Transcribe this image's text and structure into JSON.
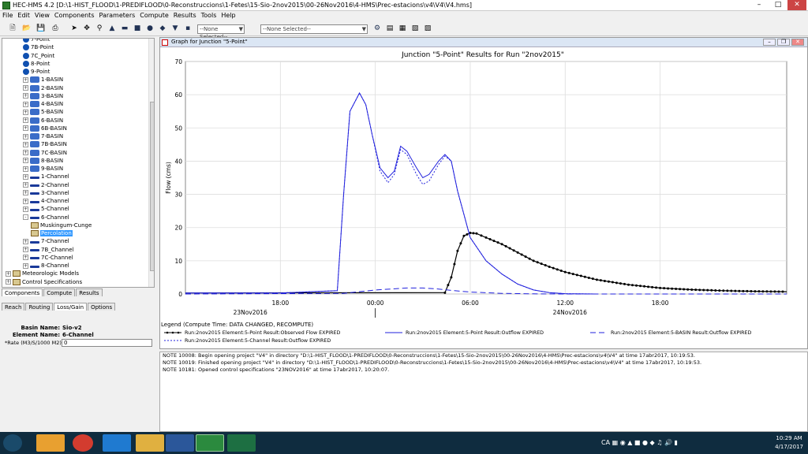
{
  "window": {
    "title": "HEC-HMS 4.2 [D:\\1-HIST_FLOOD\\1-PREDIFLOOD\\0-Reconstruccions\\1-Fetes\\15-Sio-2nov2015\\00-26Nov2016\\4-HMS\\Prec-estacions\\v4\\V4\\V4.hms]"
  },
  "menu": [
    "File",
    "Edit",
    "View",
    "Components",
    "Parameters",
    "Compute",
    "Results",
    "Tools",
    "Help"
  ],
  "toolbar": {
    "combo1": "--None Selected--",
    "combo2": "--None Selected--"
  },
  "tree": [
    {
      "label": "7-Point",
      "icon": "point-icon",
      "expand": ""
    },
    {
      "label": "7B-Point",
      "icon": "point-icon",
      "expand": ""
    },
    {
      "label": "7C_Point",
      "icon": "point-icon",
      "expand": ""
    },
    {
      "label": "8-Point",
      "icon": "point-icon",
      "expand": ""
    },
    {
      "label": "9-Point",
      "icon": "point-icon",
      "expand": ""
    },
    {
      "label": "1-BASIN",
      "icon": "basin-icon",
      "expand": "+"
    },
    {
      "label": "2-BASIN",
      "icon": "basin-icon",
      "expand": "+"
    },
    {
      "label": "3-BASIN",
      "icon": "basin-icon",
      "expand": "+"
    },
    {
      "label": "4-BASIN",
      "icon": "basin-icon",
      "expand": "+"
    },
    {
      "label": "5-BASIN",
      "icon": "basin-icon",
      "expand": "+"
    },
    {
      "label": "6-BASIN",
      "icon": "basin-icon",
      "expand": "+"
    },
    {
      "label": "6B-BASIN",
      "icon": "basin-icon",
      "expand": "+"
    },
    {
      "label": "7-BASIN",
      "icon": "basin-icon",
      "expand": "+"
    },
    {
      "label": "7B-BASIN",
      "icon": "basin-icon",
      "expand": "+"
    },
    {
      "label": "7C-BASIN",
      "icon": "basin-icon",
      "expand": "+"
    },
    {
      "label": "8-BASIN",
      "icon": "basin-icon",
      "expand": "+"
    },
    {
      "label": "9-BASIN",
      "icon": "basin-icon",
      "expand": "+"
    },
    {
      "label": "1-Channel",
      "icon": "channel-icon",
      "expand": "+"
    },
    {
      "label": "2-Channel",
      "icon": "channel-icon",
      "expand": "+"
    },
    {
      "label": "3-Channel",
      "icon": "channel-icon",
      "expand": "+"
    },
    {
      "label": "4-Channel",
      "icon": "channel-icon",
      "expand": "+"
    },
    {
      "label": "5-Channel",
      "icon": "channel-icon",
      "expand": "+"
    },
    {
      "label": "6-Channel",
      "icon": "channel-icon",
      "expand": "-"
    },
    {
      "label": "Muskingum-Cunge",
      "icon": "method-icon",
      "expand": "",
      "indent": 1
    },
    {
      "label": "Percolation",
      "icon": "method-icon",
      "expand": "",
      "indent": 1,
      "selected": true
    },
    {
      "label": "7-Channel",
      "icon": "channel-icon",
      "expand": "+"
    },
    {
      "label": "7B_Channel",
      "icon": "channel-icon",
      "expand": "+"
    },
    {
      "label": "7C-Channel",
      "icon": "channel-icon",
      "expand": "+"
    },
    {
      "label": "8-Channel",
      "icon": "channel-icon",
      "expand": "+"
    },
    {
      "label": "Meteorologic Models",
      "icon": "folder-icon",
      "expand": "+",
      "indent": -1
    },
    {
      "label": "Control Specifications",
      "icon": "folder-icon",
      "expand": "+",
      "indent": -1
    }
  ],
  "left_tabs": [
    "Components",
    "Compute",
    "Results"
  ],
  "prop_tabs": [
    "Reach",
    "Routing",
    "Loss/Gain",
    "Options"
  ],
  "props": {
    "basin_label": "Basin Name:",
    "basin_value": "Sio-v2",
    "element_label": "Element Name:",
    "element_value": "6-Channel",
    "rate_label": "*Rate (M3/S/1000 M2)",
    "rate_value": "0"
  },
  "graph_window": {
    "title": "Graph for Junction \"5-Point\""
  },
  "chart_data": {
    "type": "line",
    "title": "Junction \"5-Point\" Results for Run \"2nov2015\"",
    "ylabel": "Flow (cms)",
    "ylim": [
      0,
      70
    ],
    "yticks": [
      0,
      10,
      20,
      30,
      40,
      50,
      60,
      70
    ],
    "xlim": [
      -12,
      26
    ],
    "x_unit": "hours from 00:00 24Nov2016",
    "xticks": [
      {
        "v": -6,
        "l": "18:00"
      },
      {
        "v": 0,
        "l": "00:00"
      },
      {
        "v": 6,
        "l": "06:00"
      },
      {
        "v": 12,
        "l": "12:00"
      },
      {
        "v": 18,
        "l": "18:00"
      }
    ],
    "date_labels": [
      {
        "v": -7.9,
        "l": "23Nov2016"
      },
      {
        "v": 12.3,
        "l": "24Nov2016"
      }
    ],
    "legend_title": "Legend (Compute Time: DATA CHANGED, RECOMPUTE)",
    "series": [
      {
        "name": "Run:2nov2015 Element:5-Point Result:Observed Flow EXPIRED",
        "color": "#000000",
        "style": "dots",
        "x": [
          -12,
          4.4,
          4.8,
          5.2,
          5.6,
          6.0,
          6.4,
          7,
          8,
          9,
          10,
          11,
          12,
          14,
          16,
          18,
          20,
          22,
          24,
          26
        ],
        "y": [
          0.3,
          0.4,
          5,
          13,
          17.5,
          18.4,
          18.2,
          17,
          15,
          12.5,
          10,
          8.2,
          6.6,
          4.3,
          2.8,
          1.8,
          1.3,
          1.0,
          0.8,
          0.7
        ]
      },
      {
        "name": "Run:2nov2015 Element:5-Point Result:Outflow EXPIRED",
        "color": "#2222dd",
        "style": "solid",
        "x": [
          -12,
          -6,
          -2.4,
          -2.0,
          -1.6,
          -1.0,
          -0.6,
          -0.2,
          0.3,
          0.8,
          1.2,
          1.6,
          2.0,
          2.6,
          3.0,
          3.4,
          4.0,
          4.4,
          4.8,
          5.2,
          5.6,
          6.0,
          7,
          8,
          9,
          10,
          11,
          12,
          14
        ],
        "y": [
          0.3,
          0.3,
          1,
          30,
          55,
          60.5,
          57,
          48,
          38,
          35,
          37,
          44.5,
          43,
          38,
          35,
          36,
          40,
          42,
          40,
          31,
          24,
          17,
          10,
          6,
          3,
          1.2,
          0.4,
          0.1,
          0
        ]
      },
      {
        "name": "Run:2nov2015 Element:5-BASIN Result:Outflow EXPIRED",
        "color": "#2222dd",
        "style": "dashed",
        "x": [
          -12,
          -2,
          0,
          2,
          3,
          4,
          5,
          6,
          8,
          10,
          12,
          14,
          26
        ],
        "y": [
          0,
          0.2,
          1.2,
          1.8,
          1.8,
          1.5,
          1.0,
          0.6,
          0.2,
          0.05,
          0,
          0,
          0
        ]
      },
      {
        "name": "Run:2nov2015 Element:5-Channel Result:Outflow EXPIRED",
        "color": "#2222dd",
        "style": "dotted",
        "x": [
          -12,
          -6,
          -2.4,
          -2.0,
          -1.6,
          -1.0,
          -0.6,
          -0.2,
          0.3,
          0.8,
          1.2,
          1.6,
          2.0,
          2.6,
          3.0,
          3.4,
          4.0,
          4.4,
          4.8,
          5.2,
          5.6,
          6.0,
          7,
          8,
          9,
          10,
          11,
          12,
          14
        ],
        "y": [
          0.3,
          0.3,
          1,
          30,
          55,
          60.5,
          57,
          48,
          37,
          33.5,
          36,
          43.5,
          42,
          36,
          33,
          34,
          39,
          41.5,
          40,
          31,
          24,
          17,
          10,
          6,
          3,
          1.2,
          0.4,
          0.1,
          0
        ]
      }
    ]
  },
  "log": [
    "NOTE 10008:  Begin opening project \"V4\" in directory \"D:\\1-HIST_FLOOD\\1-PREDIFLOOD\\0-Reconstruccions\\1-Fetes\\15-Sio-2nov2015\\00-26Nov2016\\4-HMS\\Prec-estacions\\v4\\V4\" at time 17abr2017, 10:19:53.",
    "NOTE 10019:  Finished opening project \"V4\" in directory \"D:\\1-HIST_FLOOD\\1-PREDIFLOOD\\0-Reconstruccions\\1-Fetes\\15-Sio-2nov2015\\00-26Nov2016\\4-HMS\\Prec-estacions\\v4\\V4\" at time 17abr2017, 10:19:53.",
    "NOTE 10181:  Opened control specifications \"23NOV2016\" at time 17abr2017, 10:20:07."
  ],
  "taskbar": {
    "lang": "CA",
    "time": "10:29 AM",
    "date": "4/17/2017"
  }
}
